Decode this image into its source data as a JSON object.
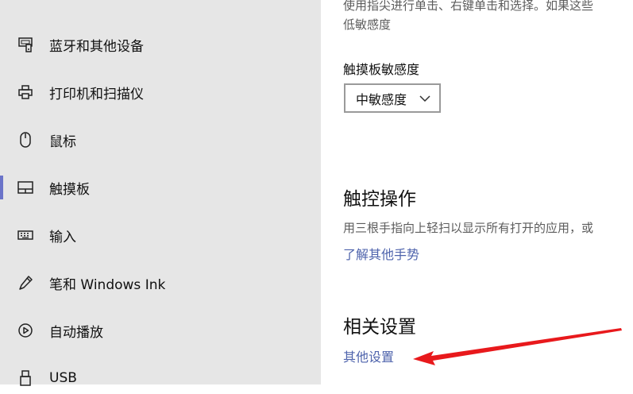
{
  "sidebar": {
    "items": [
      {
        "label": "蓝牙和其他设备",
        "icon": "bluetooth-devices-icon"
      },
      {
        "label": "打印机和扫描仪",
        "icon": "printer-icon"
      },
      {
        "label": "鼠标",
        "icon": "mouse-icon"
      },
      {
        "label": "触摸板",
        "icon": "touchpad-icon"
      },
      {
        "label": "输入",
        "icon": "keyboard-icon"
      },
      {
        "label": "笔和 Windows Ink",
        "icon": "pen-icon"
      },
      {
        "label": "自动播放",
        "icon": "autoplay-icon"
      },
      {
        "label": "USB",
        "icon": "usb-icon"
      }
    ],
    "active_index": 3
  },
  "main": {
    "top_desc_line1": "使用指尖进行单击、右键单击和选择。如果这些",
    "top_desc_line2": "低敏感度",
    "sensitivity_label": "触摸板敏感度",
    "sensitivity_value": "中敏感度",
    "gestures_title": "触控操作",
    "gestures_desc": "用三根手指向上轻扫以显示所有打开的应用，或",
    "gestures_link": "了解其他手势",
    "related_title": "相关设置",
    "related_link": "其他设置"
  },
  "annotation": {
    "arrow_color": "#e8191c"
  },
  "colors": {
    "accent": "#6b74c9",
    "link": "#4e63ac",
    "sidebar_bg": "#e6e6e6"
  }
}
